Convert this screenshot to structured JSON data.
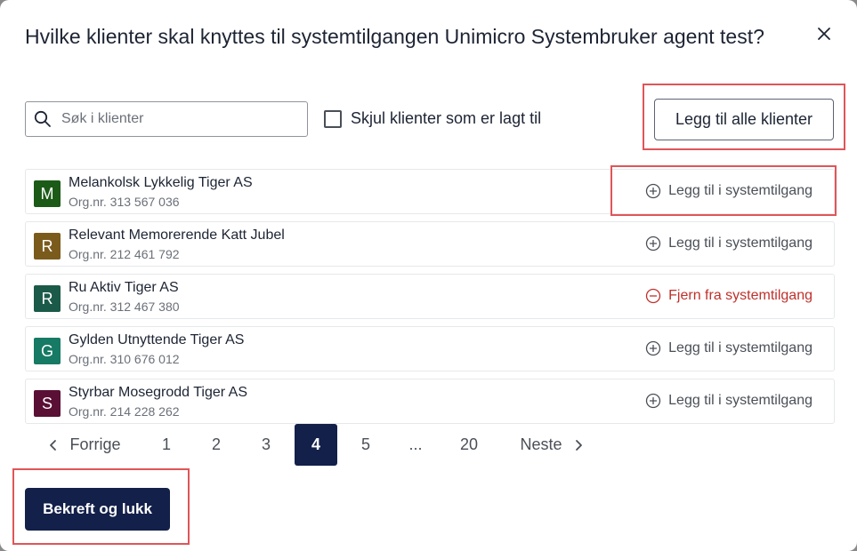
{
  "dialog": {
    "title": "Hvilke klienter skal knyttes til systemtilgangen Unimicro Systembruker agent test?"
  },
  "search": {
    "placeholder": "Søk i klienter",
    "value": ""
  },
  "filter": {
    "hide_added_label": "Skjul klienter som er lagt til",
    "checked": false
  },
  "add_all_label": "Legg til alle klienter",
  "clients": [
    {
      "initial": "M",
      "name": "Melankolsk Lykkelig Tiger AS",
      "org": "Org.nr. 313 567 036",
      "action": "Legg til i systemtilgang",
      "action_type": "add",
      "color": "#1c5a17"
    },
    {
      "initial": "R",
      "name": "Relevant Memorerende Katt Jubel",
      "org": "Org.nr. 212 461 792",
      "action": "Legg til i systemtilgang",
      "action_type": "add",
      "color": "#7a5b1c"
    },
    {
      "initial": "R",
      "name": "Ru Aktiv Tiger AS",
      "org": "Org.nr. 312 467 380",
      "action": "Fjern fra systemtilgang",
      "action_type": "remove",
      "color": "#1b5a48"
    },
    {
      "initial": "G",
      "name": "Gylden Utnyttende Tiger AS",
      "org": "Org.nr. 310 676 012",
      "action": "Legg til i systemtilgang",
      "action_type": "add",
      "color": "#167a64"
    },
    {
      "initial": "S",
      "name": "Styrbar Mosegrodd Tiger AS",
      "org": "Org.nr. 214 228 262",
      "action": "Legg til i systemtilgang",
      "action_type": "add",
      "color": "#5a0f35"
    }
  ],
  "pagination": {
    "prev_label": "Forrige",
    "next_label": "Neste",
    "pages": [
      "1",
      "2",
      "3",
      "4",
      "5",
      "...",
      "20"
    ],
    "current": "4"
  },
  "confirm_label": "Bekreft og lukk",
  "colors": {
    "primary": "#13204a",
    "remove": "#c0302b",
    "highlight": "#e05558"
  },
  "icons": {
    "close": "close-icon",
    "search": "search-icon",
    "add": "plus-circle-icon",
    "remove": "minus-circle-icon",
    "prev": "chevron-left-icon",
    "next": "chevron-right-icon"
  }
}
